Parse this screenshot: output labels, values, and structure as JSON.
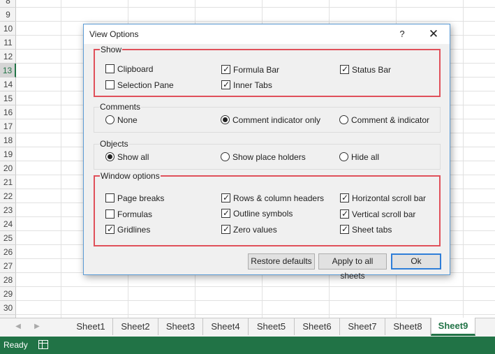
{
  "sheet": {
    "rows": [
      "8",
      "9",
      "10",
      "11",
      "12",
      "13",
      "14",
      "15",
      "16",
      "17",
      "18",
      "19",
      "20",
      "21",
      "22",
      "23",
      "24",
      "25",
      "26",
      "27",
      "28",
      "29",
      "30"
    ],
    "active_row": "13"
  },
  "sheet_tabs": {
    "tabs": [
      "Sheet1",
      "Sheet2",
      "Sheet3",
      "Sheet4",
      "Sheet5",
      "Sheet6",
      "Sheet7",
      "Sheet8",
      "Sheet9"
    ],
    "active": "Sheet9",
    "prev_icon": "triangle-left-icon",
    "next_icon": "triangle-right-icon"
  },
  "status": {
    "text": "Ready",
    "icon": "page-layout-icon"
  },
  "colors": {
    "accent": "#217346",
    "highlight_border": "#e0505a",
    "dialog_border": "#5b9bd5"
  },
  "dialog": {
    "title": "View Options",
    "help": "?",
    "close": "✕",
    "show": {
      "label": "Show",
      "options": [
        {
          "label": "Clipboard",
          "checked": false
        },
        {
          "label": "Formula Bar",
          "checked": true
        },
        {
          "label": "Status Bar",
          "checked": true
        },
        {
          "label": "Selection Pane",
          "checked": false
        },
        {
          "label": "Inner Tabs",
          "checked": true
        }
      ]
    },
    "comments": {
      "label": "Comments",
      "options": [
        {
          "label": "None",
          "selected": false
        },
        {
          "label": "Comment indicator only",
          "selected": true
        },
        {
          "label": "Comment & indicator",
          "selected": false
        }
      ]
    },
    "objects": {
      "label": "Objects",
      "options": [
        {
          "label": "Show all",
          "selected": true
        },
        {
          "label": "Show place holders",
          "selected": false
        },
        {
          "label": "Hide all",
          "selected": false
        }
      ]
    },
    "window": {
      "label": "Window options",
      "options": [
        {
          "label": "Page breaks",
          "checked": false
        },
        {
          "label": "Rows & column headers",
          "checked": true
        },
        {
          "label": "Horizontal scroll bar",
          "checked": true
        },
        {
          "label": "Formulas",
          "checked": false
        },
        {
          "label": "Outline symbols",
          "checked": true
        },
        {
          "label": "Vertical scroll bar",
          "checked": true
        },
        {
          "label": "Gridlines",
          "checked": true
        },
        {
          "label": "Zero values",
          "checked": true
        },
        {
          "label": "Sheet tabs",
          "checked": true
        }
      ]
    },
    "buttons": {
      "restore": "Restore defaults",
      "apply": "Apply to all sheets",
      "ok": "Ok"
    }
  }
}
